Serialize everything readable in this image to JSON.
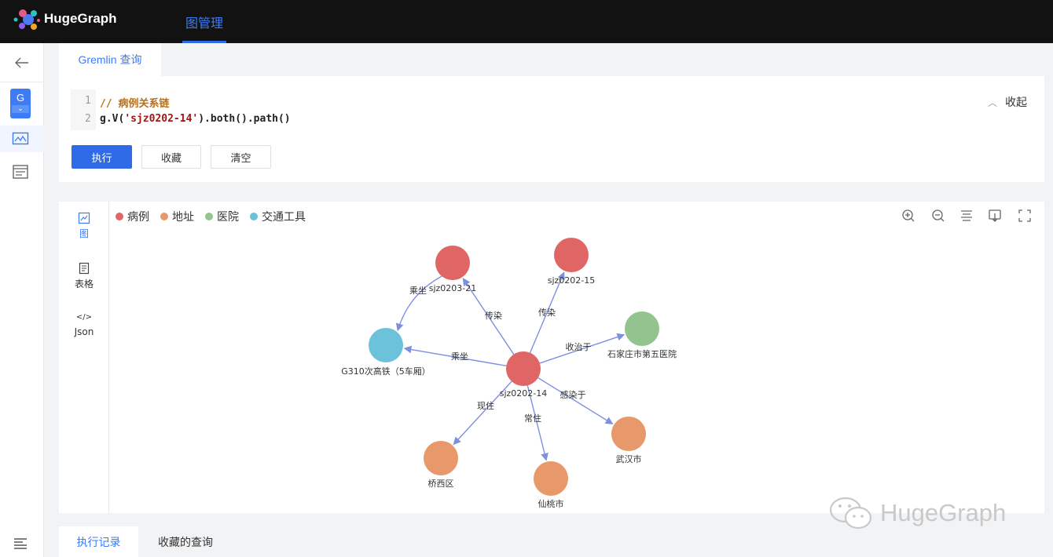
{
  "header": {
    "logo_text": "HugeGraph",
    "nav_tab": "图管理",
    "accent_color": "#2f6be6"
  },
  "sidebar": {
    "graph_letter": "G",
    "icons": [
      "back-arrow-icon",
      "graph-monitor-icon",
      "list-panel-icon",
      "menu-icon"
    ]
  },
  "query": {
    "tab_label": "Gremlin 查询",
    "lines": [
      {
        "num": "1",
        "text": "// 病例关系链"
      },
      {
        "num": "2",
        "prefix": "g.V(",
        "str": "'sjz0202-14'",
        "suffix": ").both().path()"
      }
    ],
    "collapse_label": "收起",
    "buttons": {
      "run": "执行",
      "favorite": "收藏",
      "clear": "清空"
    }
  },
  "result": {
    "views": [
      {
        "label": "图",
        "icon": "graph-view-icon"
      },
      {
        "label": "表格",
        "icon": "table-view-icon"
      },
      {
        "label": "Json",
        "icon": "code-view-icon"
      }
    ],
    "legend": [
      {
        "label": "病例",
        "color": "#e06666"
      },
      {
        "label": "地址",
        "color": "#e8996b"
      },
      {
        "label": "医院",
        "color": "#93c490"
      },
      {
        "label": "交通工具",
        "color": "#6cc2da"
      }
    ],
    "tools": [
      "zoom-in-icon",
      "zoom-out-icon",
      "layout-icon",
      "download-icon",
      "fullscreen-icon"
    ]
  },
  "graph": {
    "nodes": [
      {
        "id": "sjz0202-14",
        "label": "sjz0202-14",
        "type": "病例"
      },
      {
        "id": "sjz0203-21",
        "label": "sjz0203-21",
        "type": "病例"
      },
      {
        "id": "sjz0202-15",
        "label": "sjz0202-15",
        "type": "病例"
      },
      {
        "id": "hospital",
        "label": "石家庄市第五医院",
        "type": "医院"
      },
      {
        "id": "train",
        "label": "G310次高铁（5车厢）",
        "type": "交通工具"
      },
      {
        "id": "wuhan",
        "label": "武汉市",
        "type": "地址"
      },
      {
        "id": "xiantao",
        "label": "仙桃市",
        "type": "地址"
      },
      {
        "id": "qiaoxi",
        "label": "桥西区",
        "type": "地址"
      }
    ],
    "edges": [
      {
        "label": "传染",
        "from": "sjz0202-14",
        "to": "sjz0203-21"
      },
      {
        "label": "传染",
        "from": "sjz0202-14",
        "to": "sjz0202-15"
      },
      {
        "label": "收治于",
        "from": "sjz0202-14",
        "to": "hospital"
      },
      {
        "label": "乘坐",
        "from": "sjz0202-14",
        "to": "train"
      },
      {
        "label": "乘坐",
        "from": "sjz0203-21",
        "to": "train"
      },
      {
        "label": "感染于",
        "from": "sjz0202-14",
        "to": "wuhan"
      },
      {
        "label": "常住",
        "from": "sjz0202-14",
        "to": "xiantao"
      },
      {
        "label": "现住",
        "from": "sjz0202-14",
        "to": "qiaoxi"
      }
    ]
  },
  "bottom_tabs": {
    "history": "执行记录",
    "saved": "收藏的查询"
  },
  "watermark": "HugeGraph"
}
